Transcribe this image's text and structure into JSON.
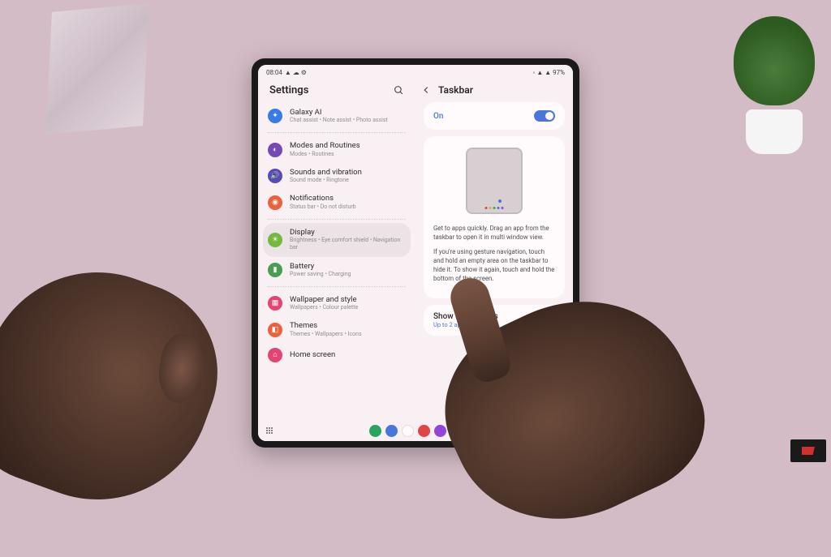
{
  "statusbar": {
    "time": "08:04",
    "battery": "97%"
  },
  "left": {
    "title": "Settings",
    "items": [
      {
        "title": "Galaxy AI",
        "sub": "Chat assist • Note assist • Photo assist",
        "iconColor": "#2873e8"
      },
      {
        "title": "Modes and Routines",
        "sub": "Modes • Routines",
        "iconColor": "#6a3fb5"
      },
      {
        "title": "Sounds and vibration",
        "sub": "Sound mode • Ringtone",
        "iconColor": "#4a3fb5"
      },
      {
        "title": "Notifications",
        "sub": "Status bar • Do not disturb",
        "iconColor": "#e85a2f"
      },
      {
        "title": "Display",
        "sub": "Brightness • Eye comfort shield • Navigation bar",
        "iconColor": "#6ab82f",
        "selected": true
      },
      {
        "title": "Battery",
        "sub": "Power saving • Charging",
        "iconColor": "#3a9a4a"
      },
      {
        "title": "Wallpaper and style",
        "sub": "Wallpapers • Colour palette",
        "iconColor": "#e03a6a"
      },
      {
        "title": "Themes",
        "sub": "Themes • Wallpapers • Icons",
        "iconColor": "#e85a2f"
      },
      {
        "title": "Home screen",
        "sub": "",
        "iconColor": "#e03a6a"
      }
    ]
  },
  "right": {
    "title": "Taskbar",
    "on": {
      "label": "On"
    },
    "desc": {
      "p1": "Get to apps quickly. Drag an app from the taskbar to open it in multi window view.",
      "p2": "If you're using gesture navigation, touch and hold an empty area on the taskbar to hide it. To show it again, touch and hold the bottom of the screen."
    },
    "recent": {
      "label": "Show recent apps",
      "sub": "Up to 2 apps"
    }
  },
  "taskbar": {
    "dotColors": [
      "#e03a3a",
      "#f0a030",
      "#3a9a4a",
      "#3a6fd8",
      "#8a3ad8"
    ]
  }
}
